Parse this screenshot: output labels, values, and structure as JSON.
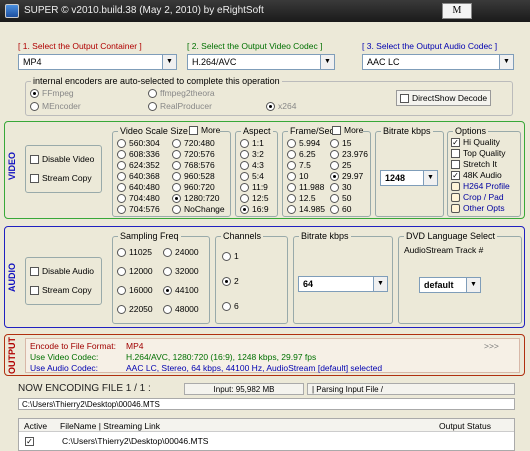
{
  "title": "SUPER © v2010.build.38 (May 2, 2010) by eRightSoft",
  "menu_btn": "M",
  "steps": {
    "s1": "[ 1.      Select the Output Container ]",
    "s2": "[ 2.     Select the Output Video Codec ]",
    "s3": "[ 3.     Select the Output Audio Codec ]"
  },
  "container": "MP4",
  "vcodec": "H.264/AVC",
  "acodec": "AAC LC",
  "encoders": {
    "legend": "internal encoders are auto-selected to complete this operation",
    "items": [
      "FFmpeg",
      "ffmpeg2theora",
      "MEncoder",
      "RealProducer",
      "x264"
    ],
    "directshow": "DirectShow Decode"
  },
  "video": {
    "side": "VIDEO",
    "disable": "Disable Video",
    "stream": "Stream Copy",
    "scale_legend": "Video Scale Size",
    "more": "More",
    "scale": [
      "560:304",
      "608:336",
      "624:352",
      "640:368",
      "640:480",
      "704:480",
      "704:576",
      "720:480",
      "720:576",
      "768:576",
      "960:528",
      "960:720",
      "1280:720",
      "NoChange"
    ],
    "aspect_legend": "Aspect",
    "aspect": [
      "1:1",
      "3:2",
      "4:3",
      "5:4",
      "11:9",
      "12:5",
      "16:9"
    ],
    "fps_legend": "Frame/Sec",
    "fps": [
      "5.994",
      "6.25",
      "7.5",
      "10",
      "11.988",
      "12.5",
      "14.985",
      "15",
      "23.976",
      "25",
      "29.97",
      "30",
      "50",
      "60"
    ],
    "bitrate_legend": "Bitrate  kbps",
    "bitrate": "1248",
    "opt_legend": "Options",
    "options": [
      "Hi Quality",
      "Top Quality",
      "Stretch It",
      "48K Audio",
      "H264 Profile",
      "Crop / Pad",
      "Other Opts"
    ]
  },
  "audio": {
    "side": "AUDIO",
    "disable": "Disable Audio",
    "stream": "Stream Copy",
    "freq_legend": "Sampling Freq",
    "freq": [
      "11025",
      "12000",
      "16000",
      "22050",
      "24000",
      "32000",
      "44100",
      "48000"
    ],
    "ch_legend": "Channels",
    "ch": [
      "1",
      "2",
      "6"
    ],
    "br_legend": "Bitrate  kbps",
    "bitrate": "64",
    "dvd_legend": "DVD Language Select",
    "dvd_sub": "AudioStream  Track #",
    "dvd": "default"
  },
  "output": {
    "side": "OUTPUT",
    "l1": "Encode to File Format:",
    "v1": "MP4",
    "arrows": ">>>",
    "l2": "Use Video Codec:",
    "v2": "H.264/AVC,  1280:720 (16:9),  1248 kbps,  29.97 fps",
    "l3": "Use Audio Codec:",
    "v3": "AAC LC,  Stereo,  64 kbps,  44100 Hz,  AudioStream [default] selected"
  },
  "status": {
    "now": "NOW ENCODING FILE 1 / 1 :",
    "input": "Input: 95,982 MB",
    "parsing": "|  Parsing Input File  /",
    "path": "C:\\Users\\Thierry2\\Desktop\\00046.MTS"
  },
  "table": {
    "headers": [
      "Active",
      "FileName  |  Streaming Link",
      "Output Status"
    ],
    "row": "C:\\Users\\Thierry2\\Desktop\\00046.MTS"
  }
}
